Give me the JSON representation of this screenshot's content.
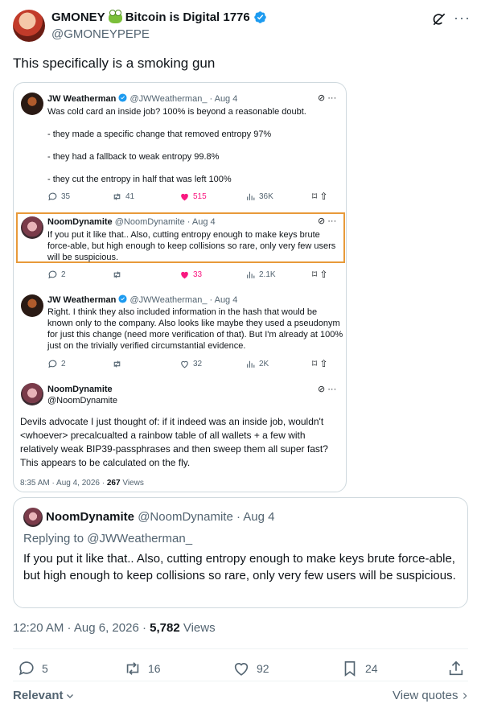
{
  "header": {
    "display_name": "GMONEY",
    "name_suffix": "Bitcoin is Digital 1776",
    "handle": "@GMONEYPEPE",
    "more_label": "···"
  },
  "tweet": {
    "text": "This specifically is a smoking gun"
  },
  "screenshot": {
    "post1": {
      "name": "JW Weatherman",
      "handle_time": "@JWWeatherman_ · Aug 4",
      "line1": "Was cold card an inside job? 100% is beyond a reasonable doubt.",
      "line2": "- they made a specific change that removed entropy 97%",
      "line3": "- they had a fallback to weak entropy 99.8%",
      "line4": "- they cut the entropy in half that was  left 100%",
      "replies": "35",
      "reposts": "41",
      "likes": "515",
      "views": "36K"
    },
    "post2": {
      "name": "NoomDynamite",
      "handle_time": "@NoomDynamite · Aug 4",
      "line1": "If you put it like that.. Also, cutting entropy enough to make keys brute",
      "line2": "force-able, but high enough to keep collisions so rare, only very few users",
      "line3": "will be suspicious.",
      "replies": "2",
      "likes": "33",
      "views": "2.1K"
    },
    "post3": {
      "name": "JW Weatherman",
      "handle_time": "@JWWeatherman_ · Aug 4",
      "line1": "Right. I think they also included information in the hash that would be",
      "line2": "known only to the company. Also looks like maybe they used a pseudonym",
      "line3": "for just this change (need more verification of that). But I'm already at 100%",
      "line4": "just on the trivially verified circumstantial evidence.",
      "replies": "2",
      "likes": "32",
      "views": "2K"
    },
    "post4": {
      "name": "NoomDynamite",
      "handle": "@NoomDynamite",
      "line1": "Devils advocate I just thought of: if it indeed was an inside job, wouldn't",
      "line2": "<whoever> precalcualted a rainbow table of all wallets + a few with",
      "line3": "relatively weak BIP39-passphrases and then sweep them all super fast?",
      "line4": "This appears to be calculated on the fly.",
      "timestamp": "8:35 AM · Aug 4, 2026 · ",
      "views_count": "267",
      "views_label": " Views"
    }
  },
  "quote": {
    "name": "NoomDynamite",
    "handle_time": " @NoomDynamite · Aug 4",
    "replying_to": "Replying to @JWWeatherman_",
    "text": "If you put it like that.. Also, cutting entropy enough to make keys brute force-able, but high enough to keep collisions so rare, only very few users will be suspicious."
  },
  "meta": {
    "time": "12:20 AM · Aug 6, 2026 · ",
    "views_count": "5,782",
    "views_label": " Views"
  },
  "actions": {
    "replies": "5",
    "reposts": "16",
    "likes": "92",
    "bookmarks": "24"
  },
  "footer": {
    "relevant_label": "Relevant",
    "view_quotes_label": "View quotes"
  },
  "colors": {
    "highlight": "#e89a3a",
    "verified": "#1d9bf0",
    "like": "#f91880"
  }
}
